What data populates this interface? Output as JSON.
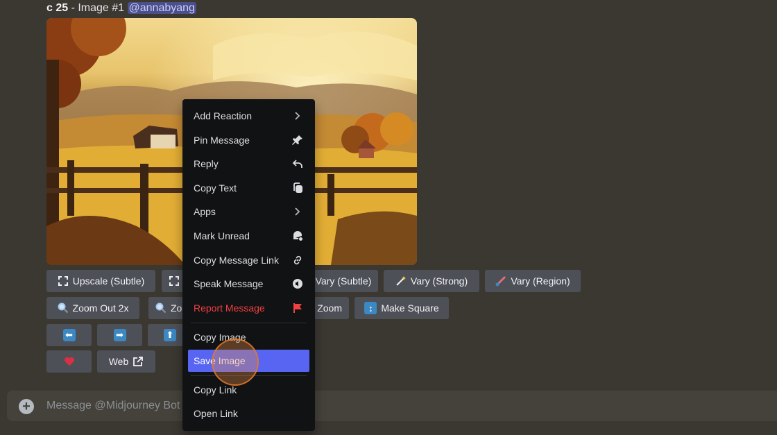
{
  "message": {
    "header_bold": "c 25",
    "header_rest": " - Image #1 ",
    "mention": "@annabyang"
  },
  "buttons": {
    "upscale_subtle": "Upscale (Subtle)",
    "vary_subtle": "Vary (Subtle)",
    "vary_strong": "Vary (Strong)",
    "vary_region": "Vary (Region)",
    "zoom_out_2x": "Zoom Out 2x",
    "zoom_partial": "Zo",
    "zoom_right": "Zoom",
    "make_square": "Make Square",
    "web": "Web"
  },
  "composer": {
    "placeholder": "Message @Midjourney Bot"
  },
  "context_menu": {
    "items": [
      {
        "label": "Add Reaction",
        "icon": "chevron-right-icon"
      },
      {
        "label": "Pin Message",
        "icon": "pin-icon"
      },
      {
        "label": "Reply",
        "icon": "reply-arrow-icon"
      },
      {
        "label": "Copy Text",
        "icon": "copy-icon"
      },
      {
        "label": "Apps",
        "icon": "chevron-right-icon"
      },
      {
        "label": "Mark Unread",
        "icon": "mark-unread-icon"
      },
      {
        "label": "Copy Message Link",
        "icon": "link-icon"
      },
      {
        "label": "Speak Message",
        "icon": "speaker-icon"
      },
      {
        "label": "Report Message",
        "icon": "flag-icon"
      },
      {
        "label": "Copy Image"
      },
      {
        "label": "Save Image"
      },
      {
        "label": "Copy Link"
      },
      {
        "label": "Open Link"
      }
    ]
  },
  "colors": {
    "danger": "#f23f42",
    "accent": "#5865f2",
    "menu_bg": "#111214"
  }
}
